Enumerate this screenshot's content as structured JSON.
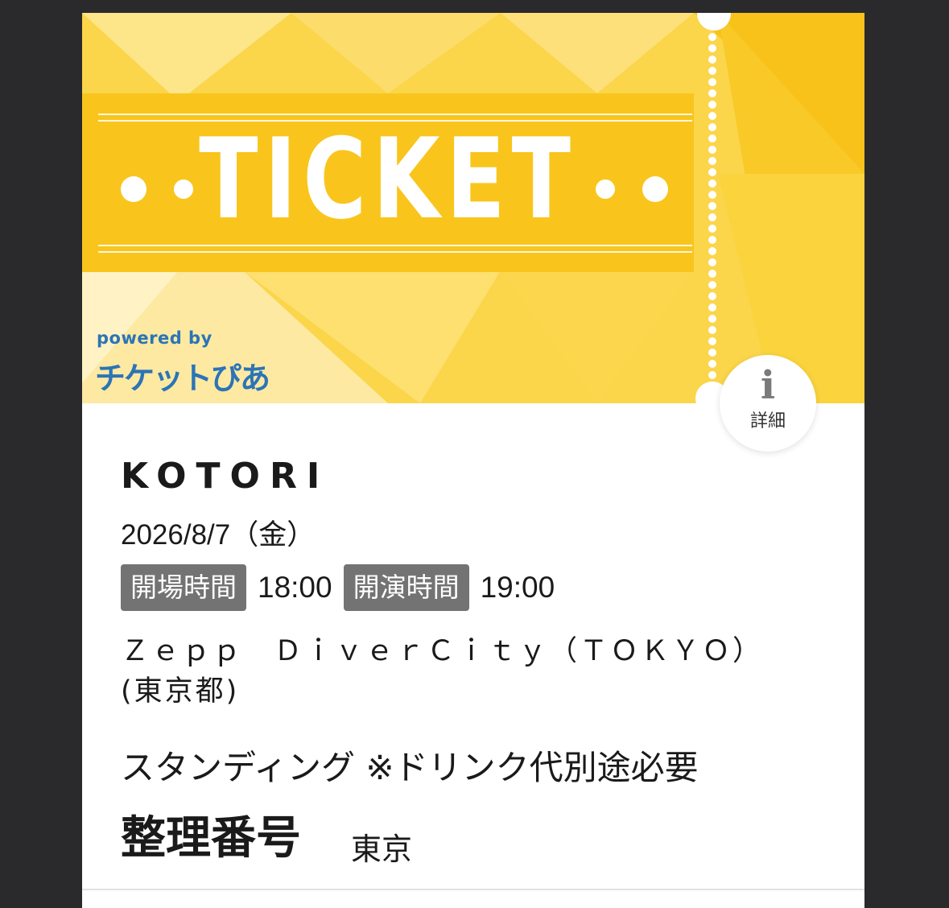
{
  "banner": {
    "title": "TICKET",
    "powered_by": "powered by",
    "brand": "チケットぴあ",
    "colors": {
      "background": "#fbd54a",
      "band": "#f9c51d",
      "brand": "#2b74b7"
    }
  },
  "info_button": {
    "icon": "info-icon",
    "label": "詳細"
  },
  "event": {
    "artist": "KOTORI",
    "date": "2026/8/7（金）",
    "open_label": "開場時間",
    "open_time": "18:00",
    "start_label": "開演時間",
    "start_time": "19:00",
    "venue": "Ｚｅｐｐ　ＤｉｖｅｒＣｉｔｙ（ＴＯＫＹＯ） (東京都)",
    "seat": "スタンディング ※ドリンク代別途必要",
    "seiri_label": "整理番号",
    "seiri_value": "東京"
  }
}
